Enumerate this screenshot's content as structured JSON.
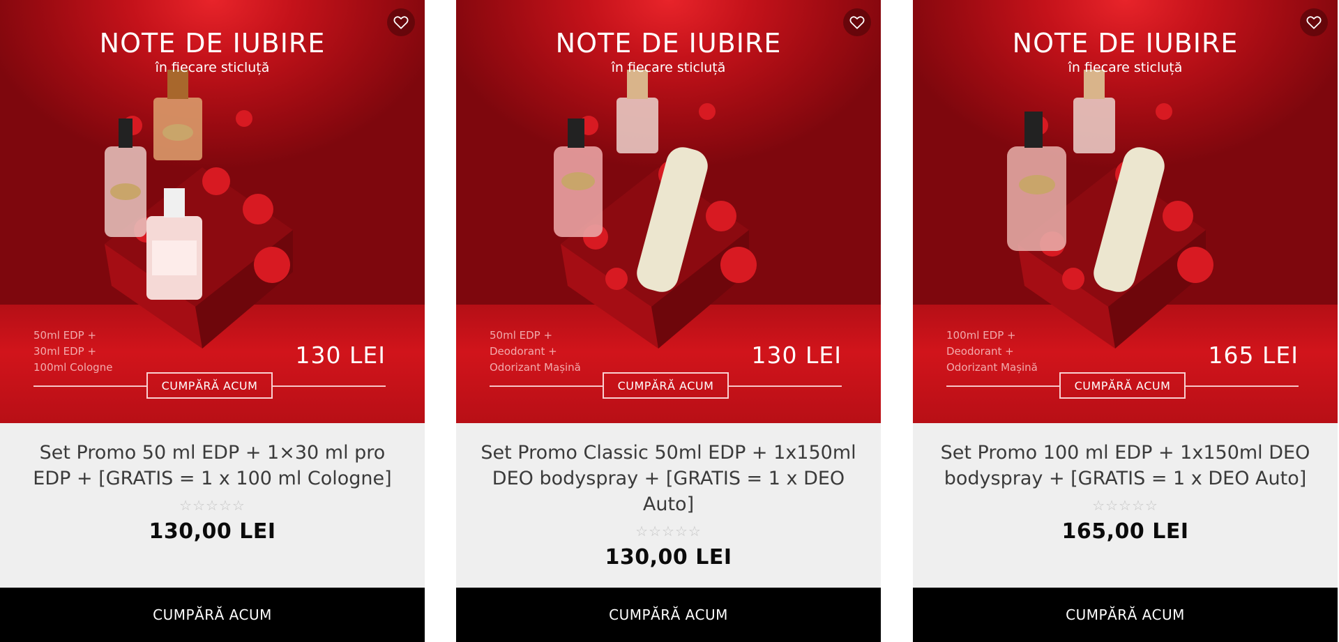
{
  "colors": {
    "promo_red": "#c4121a",
    "button_black": "#000000",
    "card_bg": "#efefef",
    "title_text": "#3a3a3a",
    "star_empty": "#c4c4c4"
  },
  "icons": {
    "favorite": "heart-outline-icon",
    "rating": "star-outline-icon"
  },
  "products": [
    {
      "promo": {
        "headline": "NOTE DE IUBIRE",
        "tagline": "în fiecare sticluță",
        "contents": [
          "50ml EDP +",
          "30ml EDP +",
          "100ml Cologne"
        ],
        "price_tag": "130 LEI",
        "cta": "CUMPĂRĂ ACUM"
      },
      "title": "Set Promo 50 ml EDP + 1×30 ml pro EDP + [GRATIS = 1 x 100 ml Cologne]",
      "rating": 0,
      "rating_max": 5,
      "stars": "☆☆☆☆☆",
      "price": "130,00 LEI",
      "button_label": "CUMPĂRĂ ACUM"
    },
    {
      "promo": {
        "headline": "NOTE DE IUBIRE",
        "tagline": "în fiecare sticluță",
        "contents": [
          "50ml EDP +",
          "Deodorant +",
          "Odorizant Mașină"
        ],
        "price_tag": "130 LEI",
        "cta": "CUMPĂRĂ ACUM"
      },
      "title": "Set Promo Classic 50ml EDP + 1x150ml DEO bodyspray + [GRATIS = 1 x DEO Auto]",
      "rating": 0,
      "rating_max": 5,
      "stars": "☆☆☆☆☆",
      "price": "130,00 LEI",
      "button_label": "CUMPĂRĂ ACUM"
    },
    {
      "promo": {
        "headline": "NOTE DE IUBIRE",
        "tagline": "în fiecare sticluță",
        "contents": [
          "100ml EDP +",
          "Deodorant +",
          "Odorizant Mașină"
        ],
        "price_tag": "165 LEI",
        "cta": "CUMPĂRĂ ACUM"
      },
      "title": "Set Promo 100 ml EDP + 1x150ml DEO bodyspray + [GRATIS = 1 x DEO Auto]",
      "rating": 0,
      "rating_max": 5,
      "stars": "☆☆☆☆☆",
      "price": "165,00 LEI",
      "button_label": "CUMPĂRĂ ACUM"
    }
  ]
}
